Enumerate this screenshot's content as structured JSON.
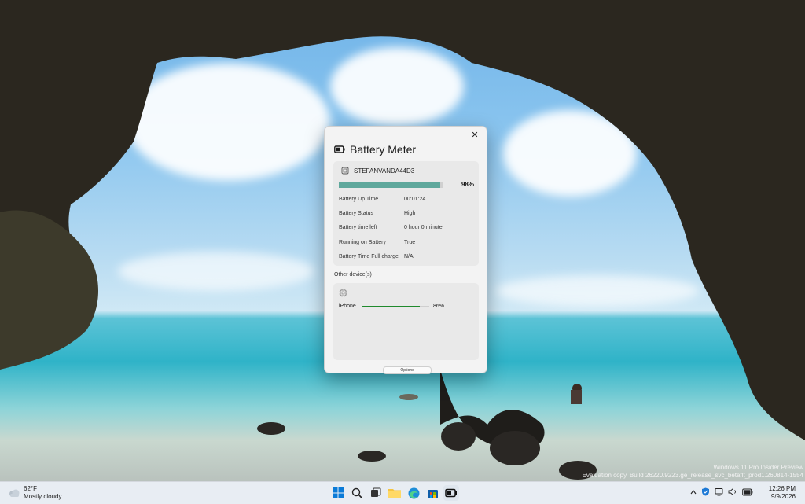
{
  "window": {
    "title": "Battery Meter",
    "close_glyph": "✕",
    "device_name": "STEFANVANDA44D3",
    "battery_percent_label": "98%",
    "battery_fraction": 0.98,
    "rows": [
      {
        "label": "Battery Up Time",
        "value": "00:01:24"
      },
      {
        "label": "Battery Status",
        "value": "High"
      },
      {
        "label": "Battery time left",
        "value": "0 hour 0 minute"
      },
      {
        "label": "Running on Battery",
        "value": "True"
      },
      {
        "label": "Battery Time Full charge",
        "value": "N/A"
      }
    ],
    "other_devices_label": "Other device(s)",
    "other_devices": [
      {
        "name": "iPhone",
        "percent_label": "86%",
        "fraction": 0.86
      }
    ],
    "options_label": "Options"
  },
  "watermark": {
    "line1": "Windows 11 Pro Insider Preview",
    "line2": "Evaluation copy. Build 26220.9223.ge_release_svc_betaflt_prod1.260814-1554"
  },
  "taskbar": {
    "weather_temp": "62°F",
    "weather_desc": "Mostly cloudy",
    "time": "12:26 PM",
    "date": "9/9/2026",
    "apps": [
      "start-icon",
      "search-icon",
      "task-view-icon",
      "file-explorer-icon",
      "edge-icon",
      "store-icon",
      "battery-meter-icon"
    ]
  },
  "colors": {
    "battery_fill": "#5fa89c",
    "iphone_fill": "#1f8a2d",
    "accent": "#0067c0"
  }
}
